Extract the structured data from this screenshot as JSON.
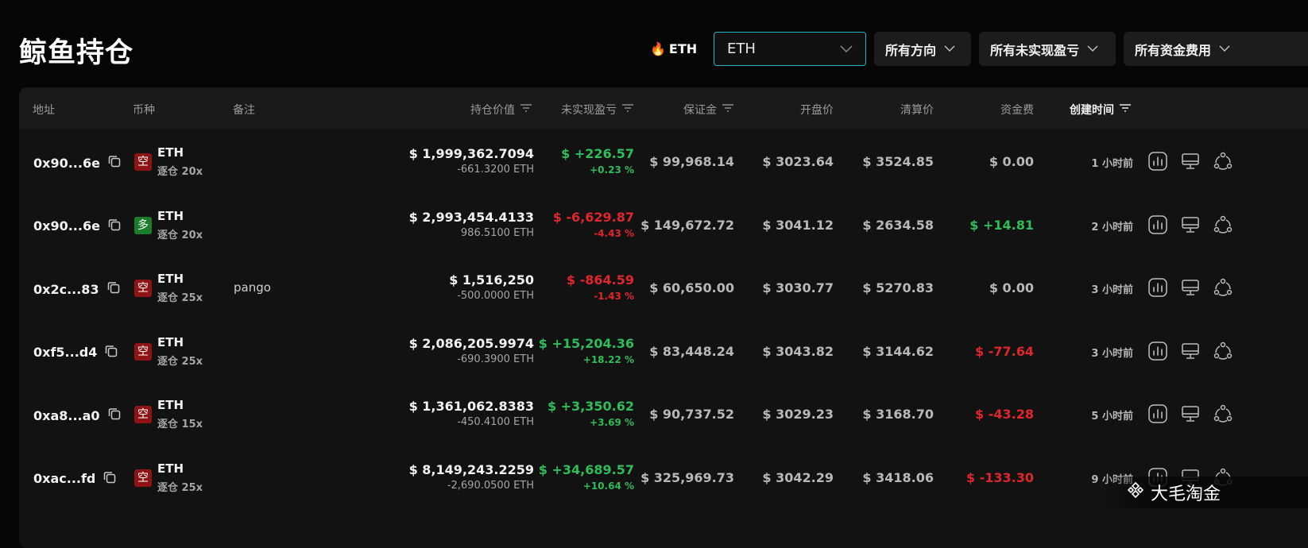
{
  "page": {
    "title": "鲸鱼持仓"
  },
  "filters": {
    "hot_label": "ETH",
    "coin_select": "ETH",
    "direction": "所有方向",
    "unrealized_pnl": "所有未实现盈亏",
    "funding_fee": "所有资金费用"
  },
  "table": {
    "headers": {
      "address": "地址",
      "coin": "币种",
      "note": "备注",
      "position_value": "持仓价值",
      "unrealized_pnl": "未实现盈亏",
      "margin": "保证金",
      "open_price": "开盘价",
      "liq_price": "清算价",
      "funding": "资金费",
      "created": "创建时间"
    },
    "rows": [
      {
        "address": "0x90...6e",
        "side": "空",
        "side_type": "short",
        "coin": "ETH",
        "leverage": "逐仓 20x",
        "note": "",
        "value": "$ 1,999,362.7094",
        "size": "-661.3200 ETH",
        "pnl": "$ +226.57",
        "pnl_pct": "+0.23 %",
        "pnl_sign": "pos",
        "margin": "$ 99,968.14",
        "open": "$ 3023.64",
        "liq": "$ 3524.85",
        "funding": "$ 0.00",
        "funding_sign": "zero",
        "time": "1 小时前"
      },
      {
        "address": "0x90...6e",
        "side": "多",
        "side_type": "long",
        "coin": "ETH",
        "leverage": "逐仓 20x",
        "note": "",
        "value": "$ 2,993,454.4133",
        "size": "986.5100 ETH",
        "pnl": "$ -6,629.87",
        "pnl_pct": "-4.43 %",
        "pnl_sign": "neg",
        "margin": "$ 149,672.72",
        "open": "$ 3041.12",
        "liq": "$ 2634.58",
        "funding": "$ +14.81",
        "funding_sign": "pos",
        "time": "2 小时前"
      },
      {
        "address": "0x2c...83",
        "side": "空",
        "side_type": "short",
        "coin": "ETH",
        "leverage": "逐仓 25x",
        "note": "pango",
        "value": "$ 1,516,250",
        "size": "-500.0000 ETH",
        "pnl": "$ -864.59",
        "pnl_pct": "-1.43 %",
        "pnl_sign": "neg",
        "margin": "$ 60,650.00",
        "open": "$ 3030.77",
        "liq": "$ 5270.83",
        "funding": "$ 0.00",
        "funding_sign": "zero",
        "time": "3 小时前"
      },
      {
        "address": "0xf5...d4",
        "side": "空",
        "side_type": "short",
        "coin": "ETH",
        "leverage": "逐仓 25x",
        "note": "",
        "value": "$ 2,086,205.9974",
        "size": "-690.3900 ETH",
        "pnl": "$ +15,204.36",
        "pnl_pct": "+18.22 %",
        "pnl_sign": "pos",
        "margin": "$ 83,448.24",
        "open": "$ 3043.82",
        "liq": "$ 3144.62",
        "funding": "$ -77.64",
        "funding_sign": "neg",
        "time": "3 小时前"
      },
      {
        "address": "0xa8...a0",
        "side": "空",
        "side_type": "short",
        "coin": "ETH",
        "leverage": "逐仓 15x",
        "note": "",
        "value": "$ 1,361,062.8383",
        "size": "-450.4100 ETH",
        "pnl": "$ +3,350.62",
        "pnl_pct": "+3.69 %",
        "pnl_sign": "pos",
        "margin": "$ 90,737.52",
        "open": "$ 3029.23",
        "liq": "$ 3168.70",
        "funding": "$ -43.28",
        "funding_sign": "neg",
        "time": "5 小时前"
      },
      {
        "address": "0xac...fd",
        "side": "空",
        "side_type": "short",
        "coin": "ETH",
        "leverage": "逐仓 25x",
        "note": "",
        "value": "$ 8,149,243.2259",
        "size": "-2,690.0500 ETH",
        "pnl": "$ +34,689.57",
        "pnl_pct": "+10.64 %",
        "pnl_sign": "pos",
        "margin": "$ 325,969.73",
        "open": "$ 3042.29",
        "liq": "$ 3418.06",
        "funding": "$ -133.30",
        "funding_sign": "neg",
        "time": "9 小时前"
      }
    ]
  },
  "watermark": {
    "text": "大毛淘金"
  },
  "colors": {
    "positive": "#2ebd5a",
    "negative": "#e0262c",
    "short_badge": "#8e1414",
    "long_badge": "#1a7d2b",
    "accent_border": "#27b3bf"
  }
}
